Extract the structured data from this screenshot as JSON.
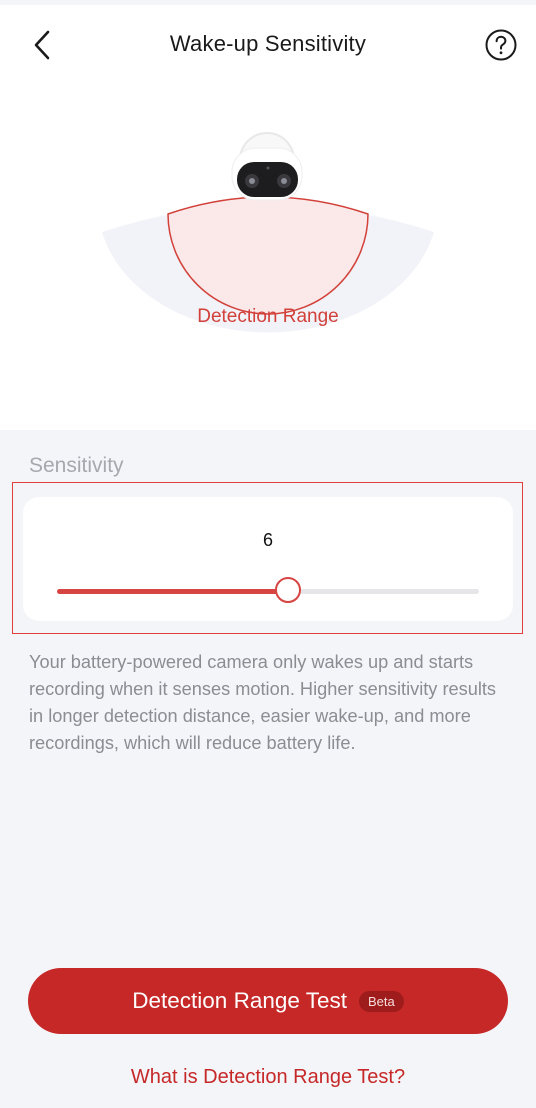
{
  "header": {
    "title": "Wake-up Sensitivity",
    "back_icon": "chevron-left-icon",
    "help_icon": "question-circle-icon"
  },
  "illustration": {
    "range_label": "Detection Range"
  },
  "sensitivity": {
    "section_label": "Sensitivity",
    "value": "6",
    "min": 1,
    "max": 11,
    "fill_fraction": 0.55
  },
  "description": "Your battery-powered camera only wakes up and starts recording when it senses motion. Higher sensitivity results in longer detection distance, easier wake-up, and more recordings, which will reduce battery life.",
  "test_button": {
    "label": "Detection Range Test",
    "badge": "Beta"
  },
  "help_link": "What is Detection Range Test?",
  "colors": {
    "accent": "#c62828",
    "range_stroke": "#d2413a",
    "range_fill": "#fbe9e9",
    "background": "#f4f5f9"
  }
}
